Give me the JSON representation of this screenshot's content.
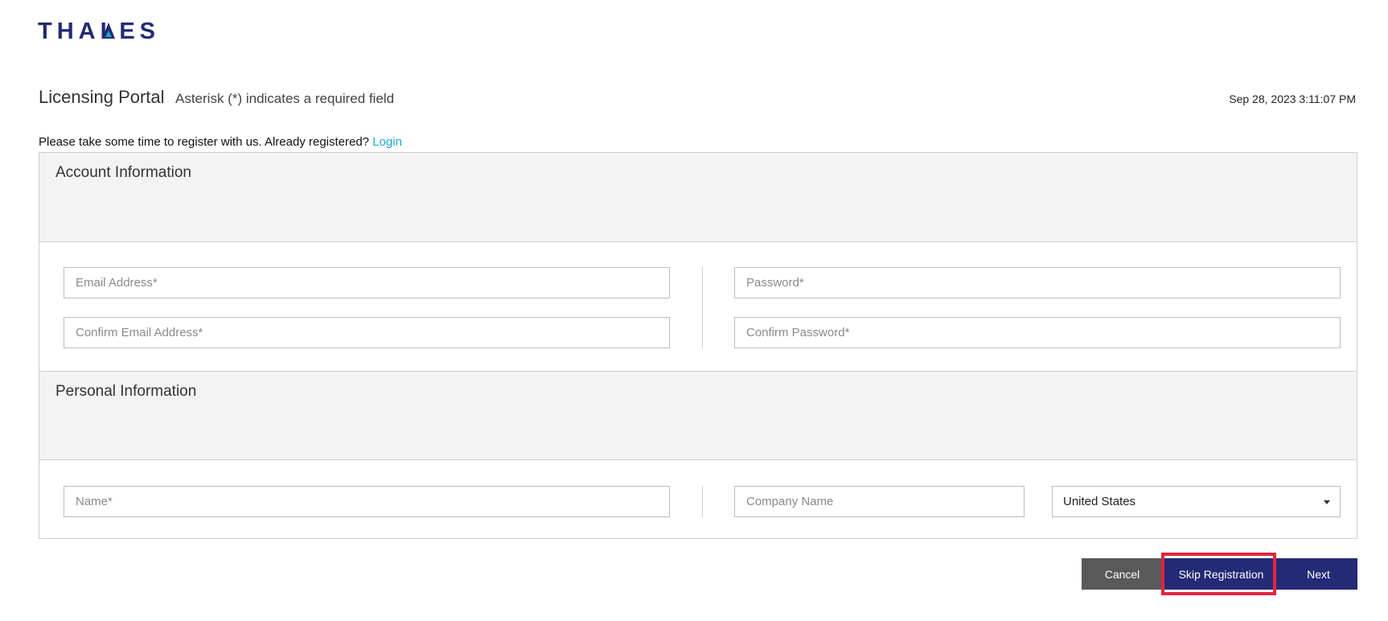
{
  "brand": {
    "logo_text": "THALES",
    "color": "#242a75",
    "accent": "#1aa8c9"
  },
  "header": {
    "title": "Licensing Portal",
    "required_note": "Asterisk (*) indicates a required field",
    "timestamp": "Sep 28, 2023 3:11:07 PM"
  },
  "intro": {
    "text": "Please take some time to register with us. Already registered?",
    "login_link": "Login"
  },
  "account_section": {
    "title": "Account Information",
    "fields": {
      "email": {
        "placeholder": "Email Address*",
        "value": ""
      },
      "confirm_email": {
        "placeholder": "Confirm Email Address*",
        "value": ""
      },
      "password": {
        "placeholder": "Password*",
        "value": ""
      },
      "confirm_password": {
        "placeholder": "Confirm Password*",
        "value": ""
      }
    }
  },
  "personal_section": {
    "title": "Personal Information",
    "fields": {
      "name": {
        "placeholder": "Name*",
        "value": ""
      },
      "company": {
        "placeholder": "Company Name",
        "value": ""
      },
      "country": {
        "selected": "United States"
      }
    }
  },
  "buttons": {
    "cancel": "Cancel",
    "skip": "Skip Registration",
    "next": "Next"
  },
  "colors": {
    "cancel_bg": "#595959",
    "primary_bg": "#242a75",
    "highlight": "#e3253e",
    "section_bg": "#f2f3f2"
  }
}
